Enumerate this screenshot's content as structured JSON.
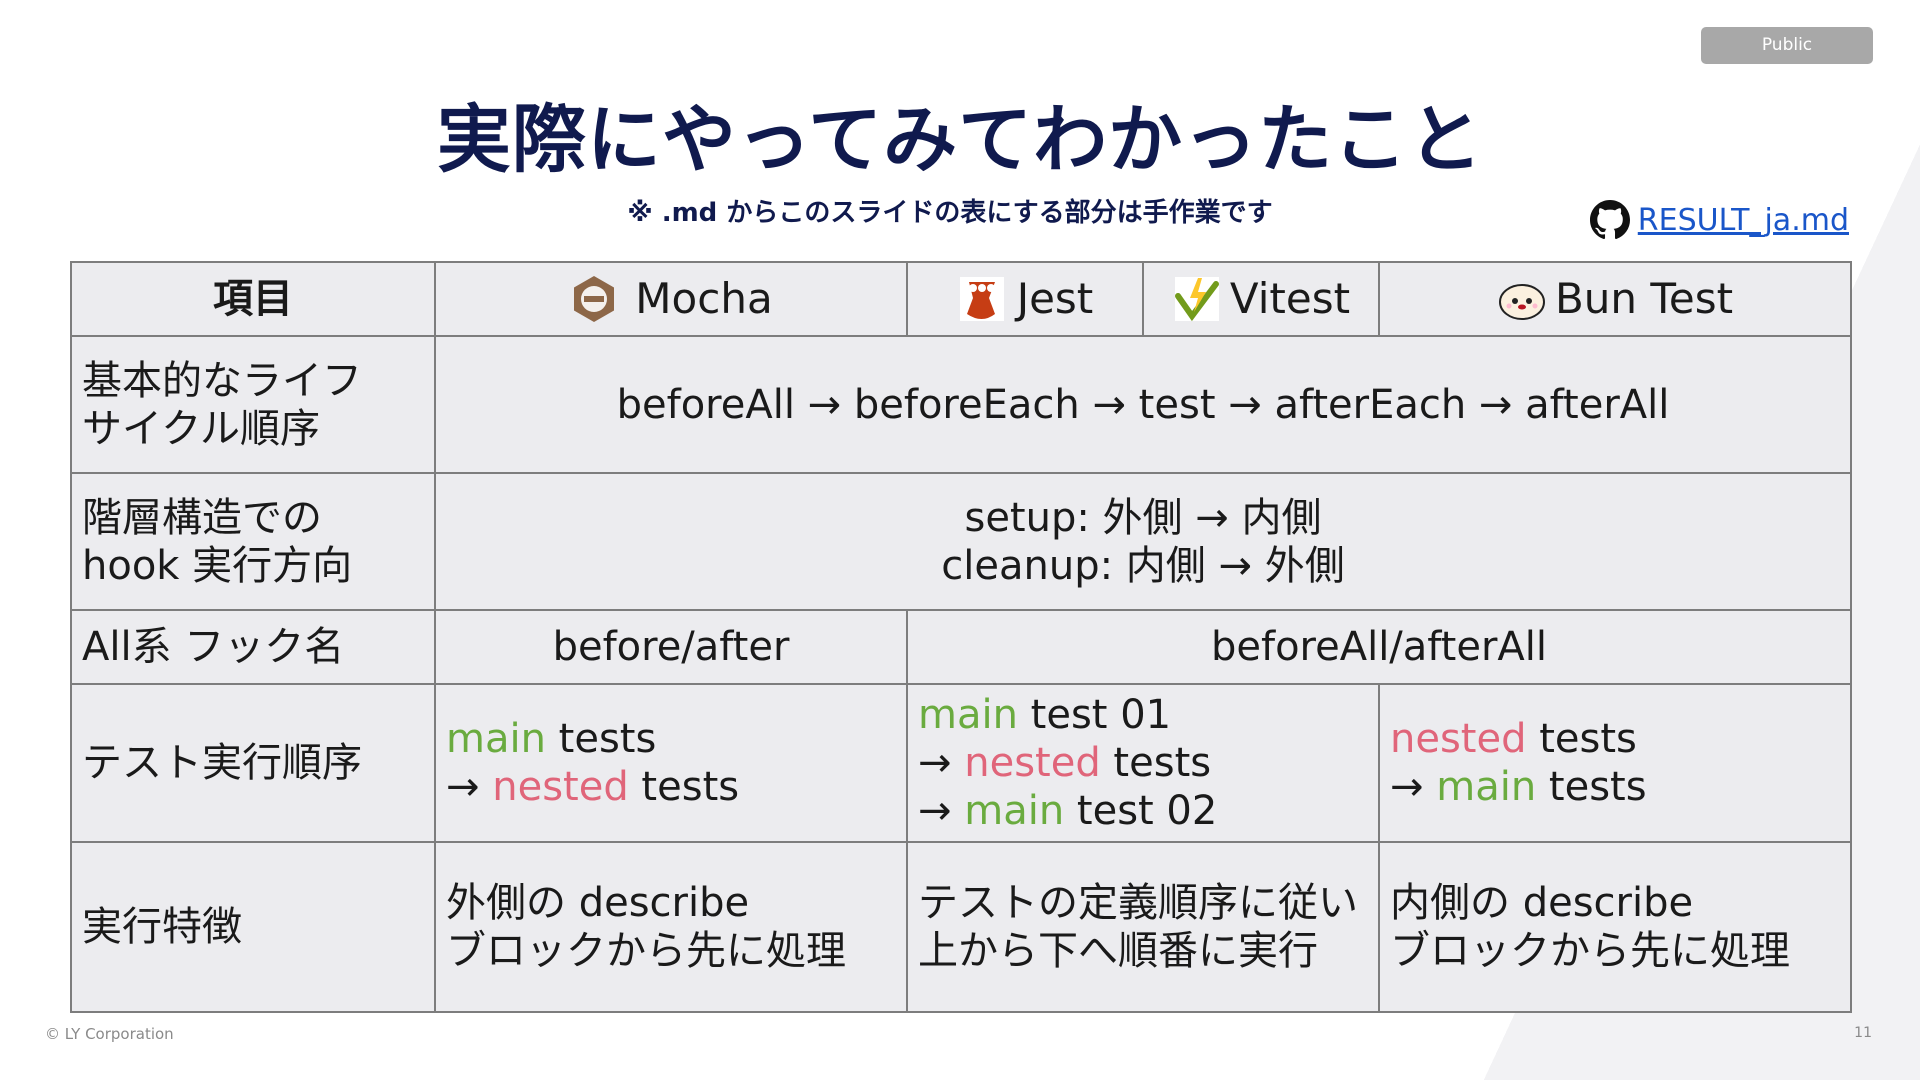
{
  "badge": "Public",
  "title": "実際にやってみてわかったこと",
  "subtitle": "※ .md からこのスライドの表にする部分は手作業です",
  "link": {
    "label": "RESULT_ja.md"
  },
  "table": {
    "header": {
      "item": "項目",
      "mocha": "Mocha",
      "jest": "Jest",
      "vitest": "Vitest",
      "bun": "Bun Test"
    },
    "rows": {
      "lifecycle": {
        "label_l1": "基本的なライフ",
        "label_l2": "サイクル順序",
        "value": "beforeAll → beforeEach → test → afterEach → afterAll"
      },
      "hook_direction": {
        "label_l1": "階層構造での",
        "label_l2": "hook 実行方向",
        "line1": "setup: 外側 → 内側",
        "line2": "cleanup: 内側 → 外側"
      },
      "all_hook": {
        "label": "All系 フック名",
        "mocha": "before/after",
        "others": "beforeAll/afterAll"
      },
      "exec_order": {
        "label": "テスト実行順序",
        "mocha": {
          "w1": "main",
          "t1": " tests",
          "arrow": "→ ",
          "w2": "nested",
          "t2": " tests"
        },
        "jest_vitest": {
          "w1": "main",
          "t1": " test 01",
          "arrow": "→ ",
          "w2": "nested",
          "t2": " tests",
          "w3": "main",
          "t3": " test 02"
        },
        "bun": {
          "w1": "nested",
          "t1": " tests",
          "arrow": "→ ",
          "w2": "main",
          "t2": " tests"
        }
      },
      "traits": {
        "label": "実行特徴",
        "mocha_l1": "外側の describe",
        "mocha_l2": "ブロックから先に処理",
        "jv_l1": "テストの定義順序に従い",
        "jv_l2": "上から下へ順番に実行",
        "bun_l1": "内側の describe",
        "bun_l2": "ブロックから先に処理"
      }
    }
  },
  "footer": {
    "copyright": "© LY Corporation",
    "page": "11"
  },
  "colors": {
    "title": "#101a4e",
    "green": "#6aab3f",
    "pink": "#e0657a",
    "link": "#1a56c9"
  },
  "icons": [
    "github-icon",
    "mocha-logo-icon",
    "jest-logo-icon",
    "vitest-logo-icon",
    "bun-logo-icon"
  ]
}
